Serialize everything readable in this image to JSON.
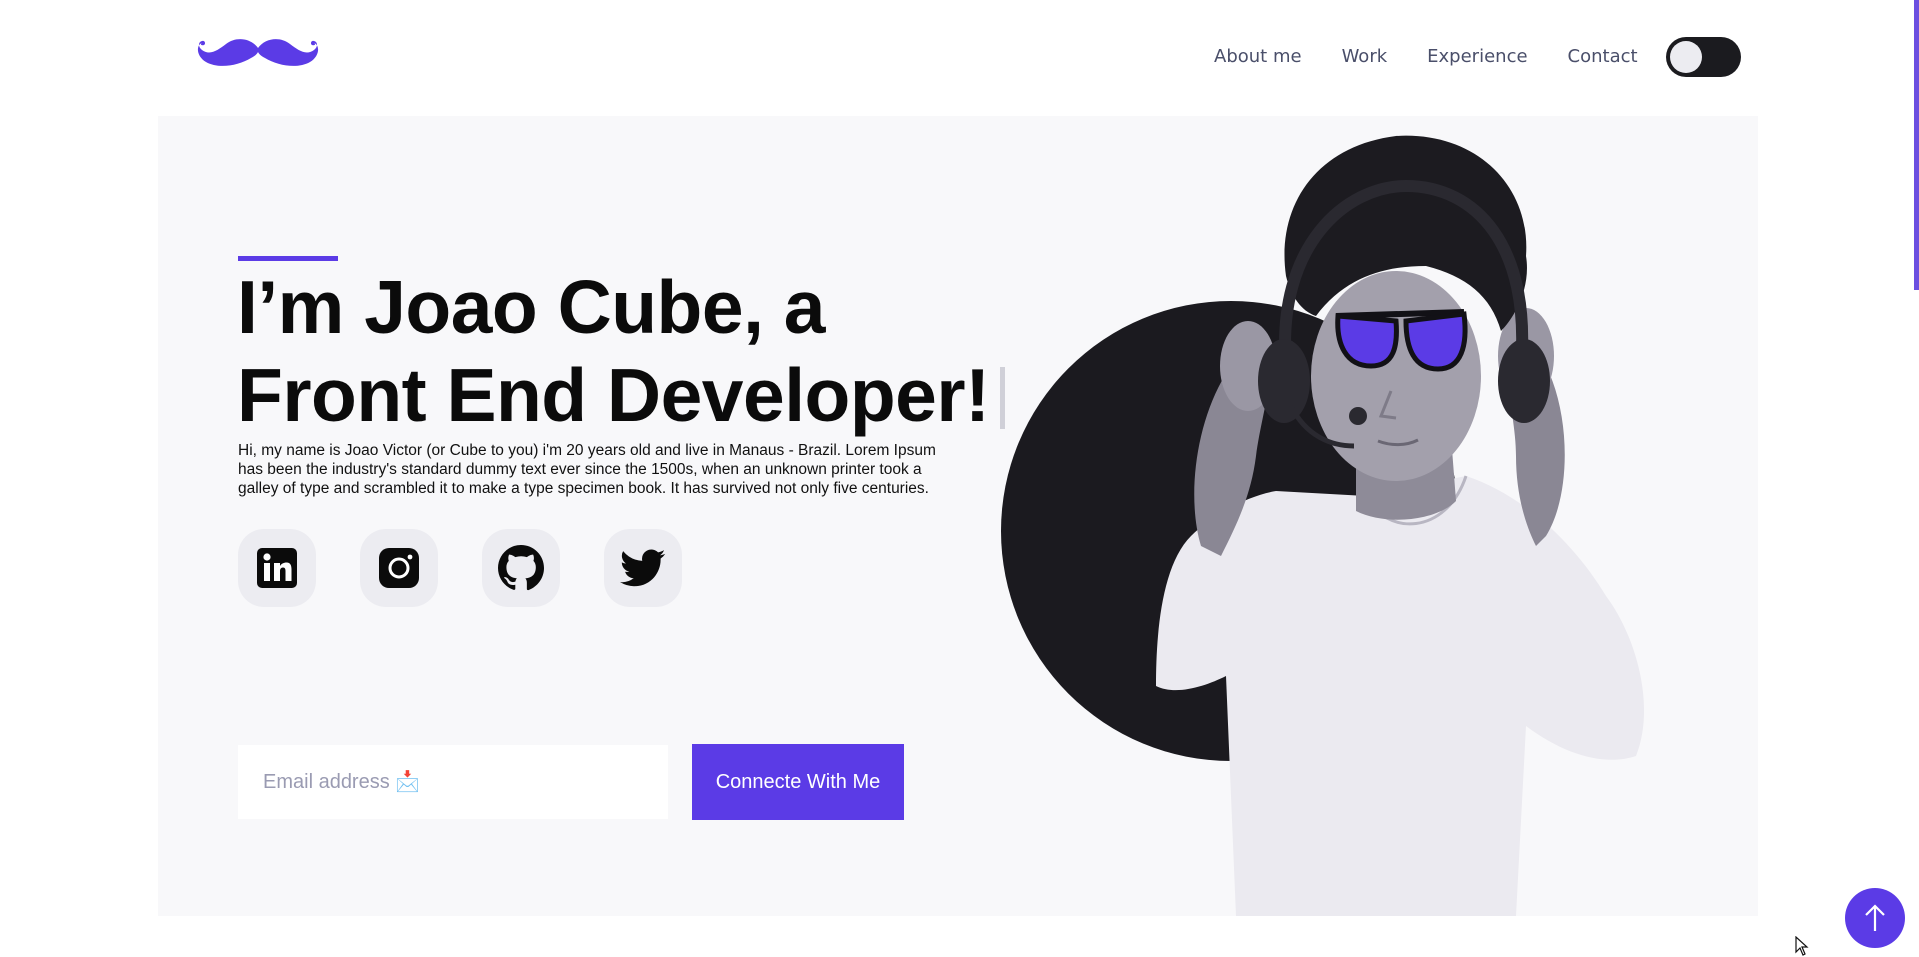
{
  "header": {
    "logo_icon": "mustache-logo",
    "nav": [
      {
        "label": "About me"
      },
      {
        "label": "Work"
      },
      {
        "label": "Experience"
      },
      {
        "label": "Contact"
      }
    ],
    "theme_toggle_icon": "toggle-switch"
  },
  "hero": {
    "headline_line1": "I’m Joao Cube, a",
    "headline_line2": "Front End Developer!",
    "intro": "Hi, my name is Joao Victor (or Cube to you) i'm 20 years old and live in Manaus - Brazil. Lorem Ipsum has been the industry's standard dummy text ever since the 1500s, when an unknown printer took a galley of type and scrambled it to make a type specimen book. It has survived not only five centuries.",
    "socials": [
      {
        "icon": "linkedin-icon"
      },
      {
        "icon": "instagram-icon"
      },
      {
        "icon": "github-icon"
      },
      {
        "icon": "twitter-icon"
      }
    ],
    "email_placeholder": "Email address 📩",
    "connect_label": "Connecte With Me"
  },
  "colors": {
    "accent": "#5b3be6",
    "hero_bg": "#f8f8fa",
    "dark": "#1b1b1f"
  },
  "scroll_top_icon": "arrow-up-icon"
}
